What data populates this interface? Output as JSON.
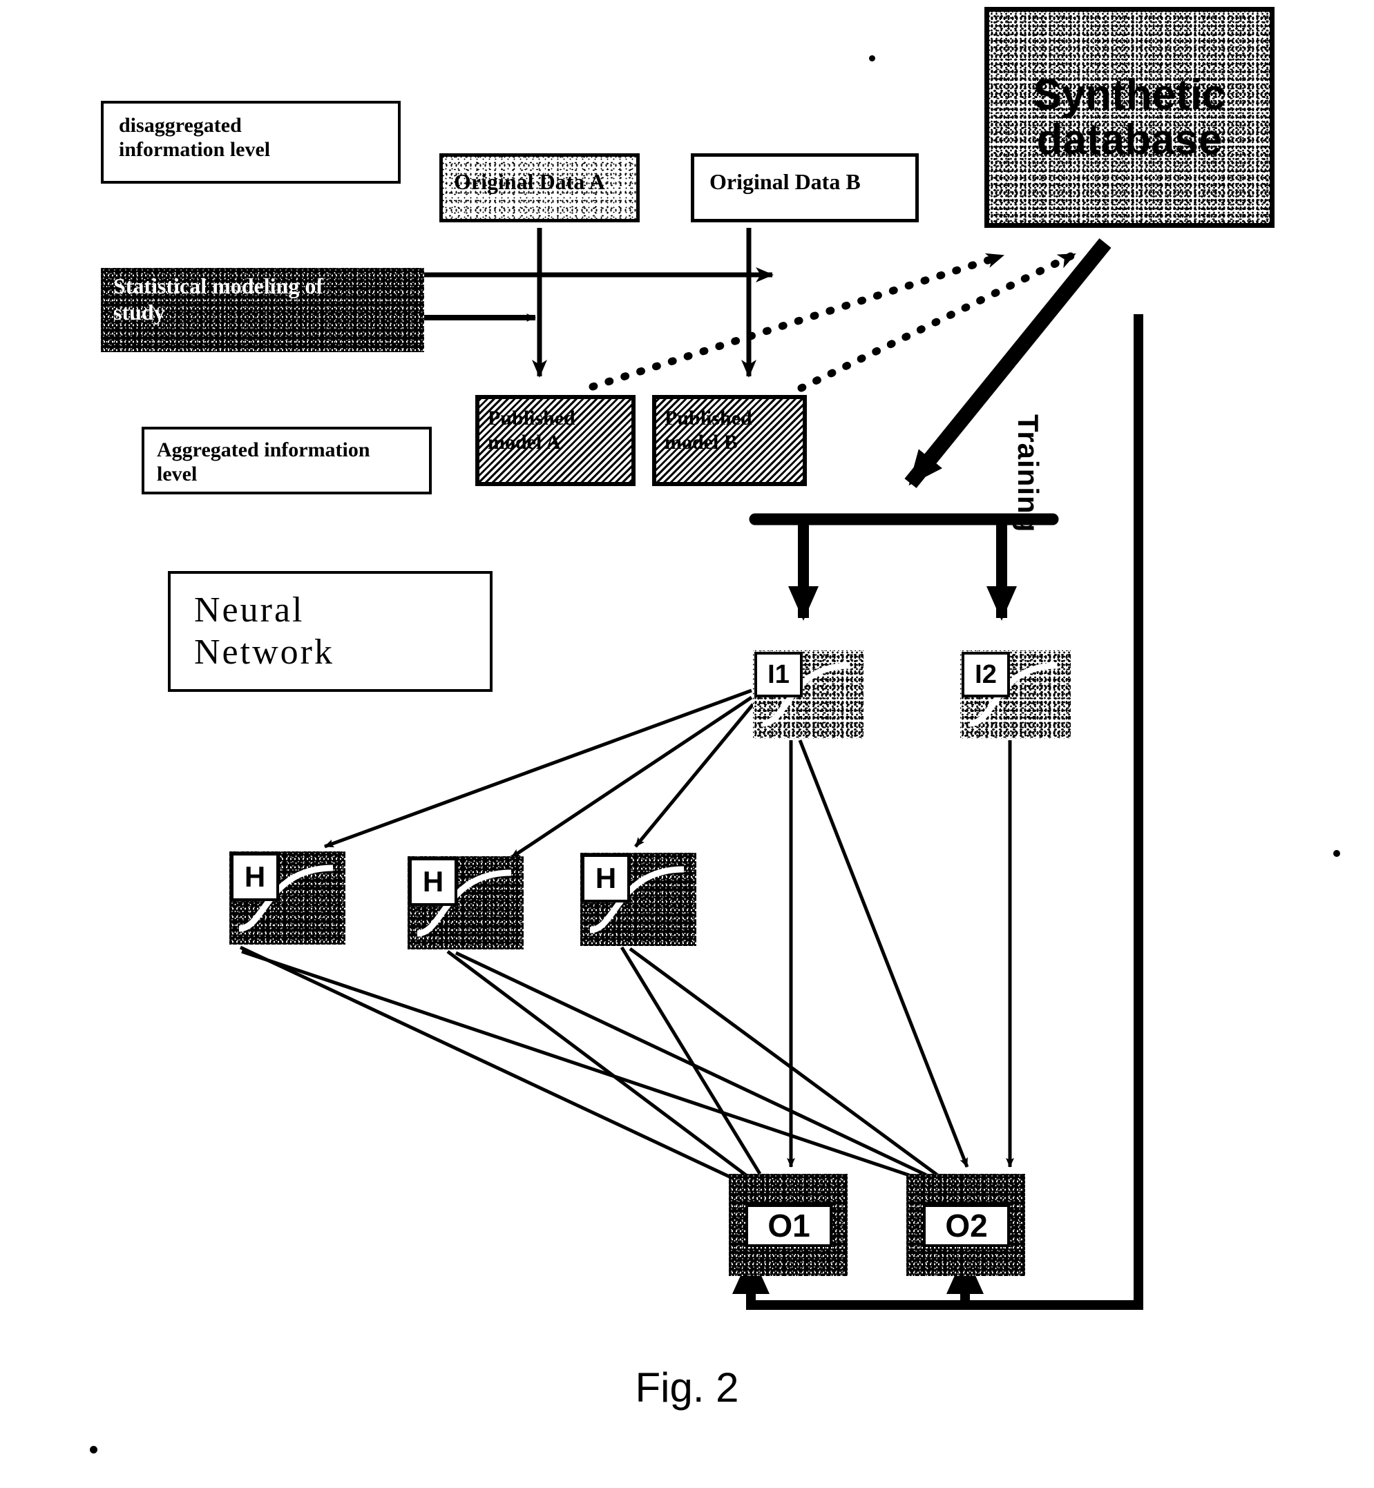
{
  "figure": {
    "caption": "Fig. 2",
    "title_blocks": {
      "disaggregated": "disaggregated\ninformation level",
      "aggregated": "Aggregated information\nlevel",
      "neural_network": "Neural\nNetwork"
    }
  },
  "data_sources": {
    "original_a": "Original Data A",
    "original_b": "Original Data B",
    "synthetic_db": "Synthetic\ndatabase"
  },
  "models": {
    "statistical_modeling": "Statistical modeling of\nstudy",
    "published_a": "Published\nmodel A",
    "published_b": "Published\nmodel B"
  },
  "network": {
    "training_label": "Training",
    "input_nodes": [
      {
        "id": "I1",
        "label": "I1"
      },
      {
        "id": "I2",
        "label": "I2"
      }
    ],
    "hidden_nodes": [
      {
        "id": "H1",
        "label": "H"
      },
      {
        "id": "H2",
        "label": "H"
      },
      {
        "id": "H3",
        "label": "H"
      }
    ],
    "output_nodes": [
      {
        "id": "O1",
        "label": "O1"
      },
      {
        "id": "O2",
        "label": "O2"
      }
    ]
  },
  "colors": {
    "ink": "#000000",
    "paper": "#ffffff"
  }
}
